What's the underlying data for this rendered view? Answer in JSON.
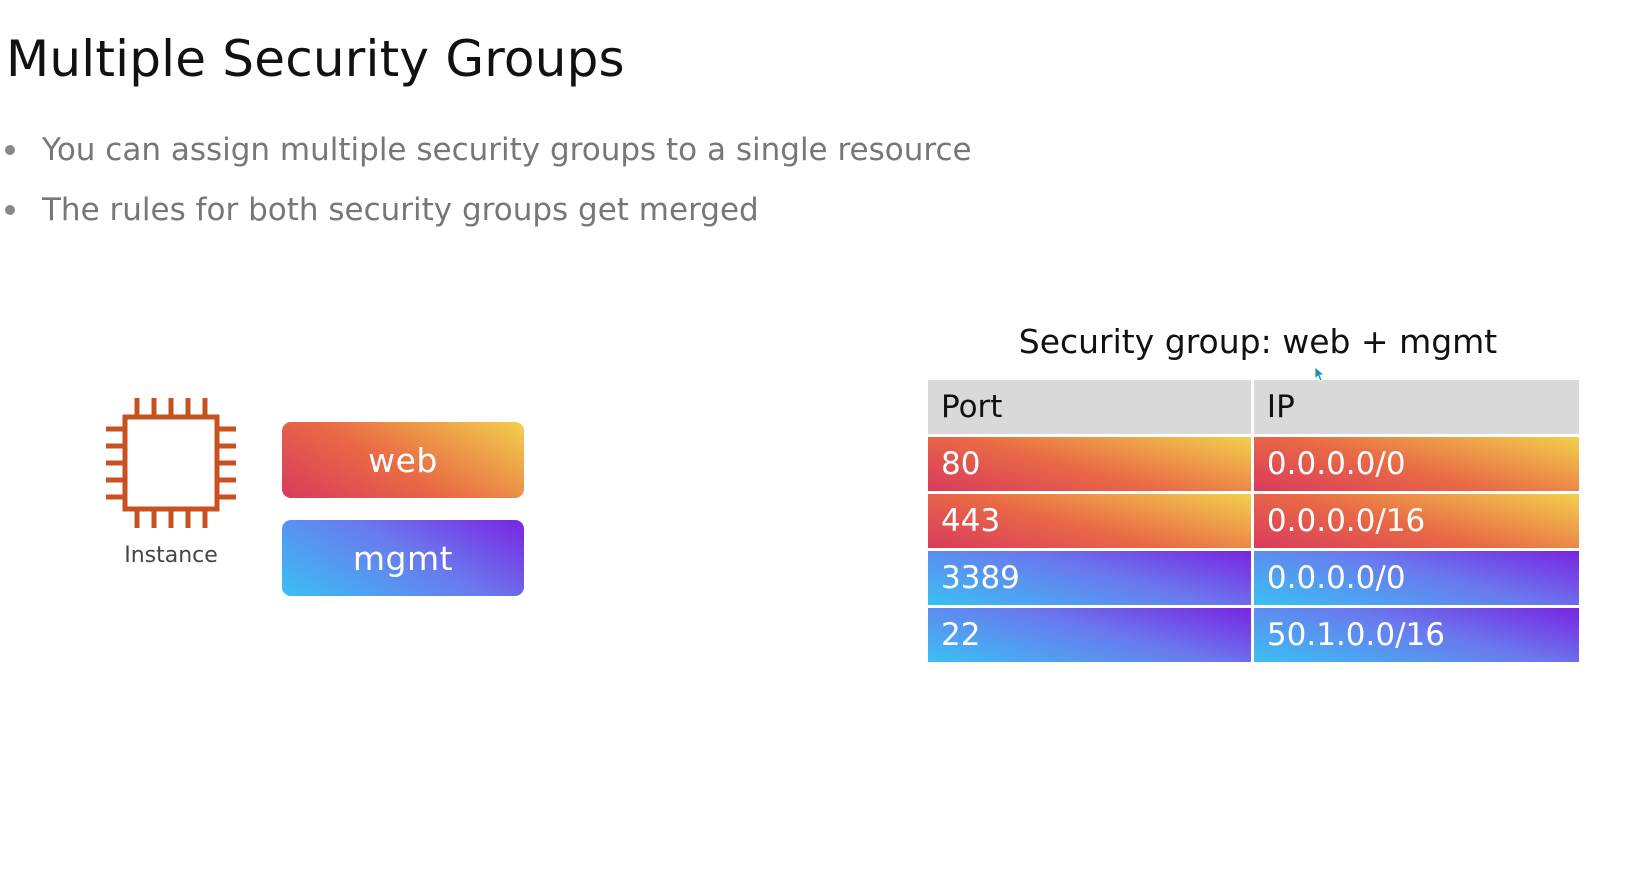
{
  "slide": {
    "title": "Multiple Security Groups",
    "bullets": [
      "You can assign multiple security groups to a single resource",
      "The rules for both security groups get merged"
    ]
  },
  "diagram": {
    "instance_label": "Instance",
    "instance_icon": "chip-icon",
    "instance_color": "#c7511f",
    "security_groups": [
      {
        "label": "web",
        "color_start": "#d93a5c",
        "color_end": "#f2d04c"
      },
      {
        "label": "mgmt",
        "color_start": "#3ac0f4",
        "color_end": "#7a24e2"
      }
    ]
  },
  "merged_table": {
    "title": "Security group: web + mgmt",
    "headers": {
      "port": "Port",
      "ip": "IP"
    },
    "rows": [
      {
        "port": "80",
        "ip": "0.0.0.0/0",
        "group": "web"
      },
      {
        "port": "443",
        "ip": "0.0.0.0/16",
        "group": "web"
      },
      {
        "port": "3389",
        "ip": "0.0.0.0/0",
        "group": "mgmt"
      },
      {
        "port": "22",
        "ip": "50.1.0.0/16",
        "group": "mgmt"
      }
    ]
  }
}
